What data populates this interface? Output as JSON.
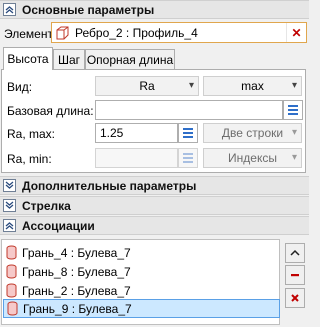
{
  "sections": {
    "main": "Основные параметры",
    "additional": "Дополнительные параметры",
    "arrow": "Стрелка",
    "associations": "Ассоциации"
  },
  "element": {
    "label": "Элемент:",
    "value": "Ребро_2 : Профиль_4",
    "clear_icon": "x-icon"
  },
  "tabs": [
    {
      "label": "Высота",
      "active": true
    },
    {
      "label": "Шаг",
      "active": false
    },
    {
      "label": "Опорная длина",
      "active": false
    }
  ],
  "form": {
    "view_label": "Вид:",
    "view_value": "Ra",
    "view_mode": "max",
    "base_length_label": "Базовая длина:",
    "base_length_value": "",
    "ra_max_label": "Ra, max:",
    "ra_max_value": "1.25",
    "ra_max_option": "Две строки",
    "ra_min_label": "Ra, min:",
    "ra_min_value": "",
    "ra_min_option": "Индексы"
  },
  "associations": {
    "items": [
      {
        "label": "Грань_4 : Булева_7",
        "selected": false
      },
      {
        "label": "Грань_8 : Булева_7",
        "selected": false
      },
      {
        "label": "Грань_2 : Булева_7",
        "selected": false
      },
      {
        "label": "Грань_9 : Булева_7",
        "selected": true
      }
    ],
    "buttons": [
      "move-up-icon",
      "remove-icon",
      "delete-icon"
    ]
  },
  "colors": {
    "accent_border": "#e0a64d",
    "selection_bg": "#cce8ff",
    "selection_border": "#5aa0e6",
    "delete_red": "#c00000",
    "list_blue": "#2f6fc9"
  }
}
